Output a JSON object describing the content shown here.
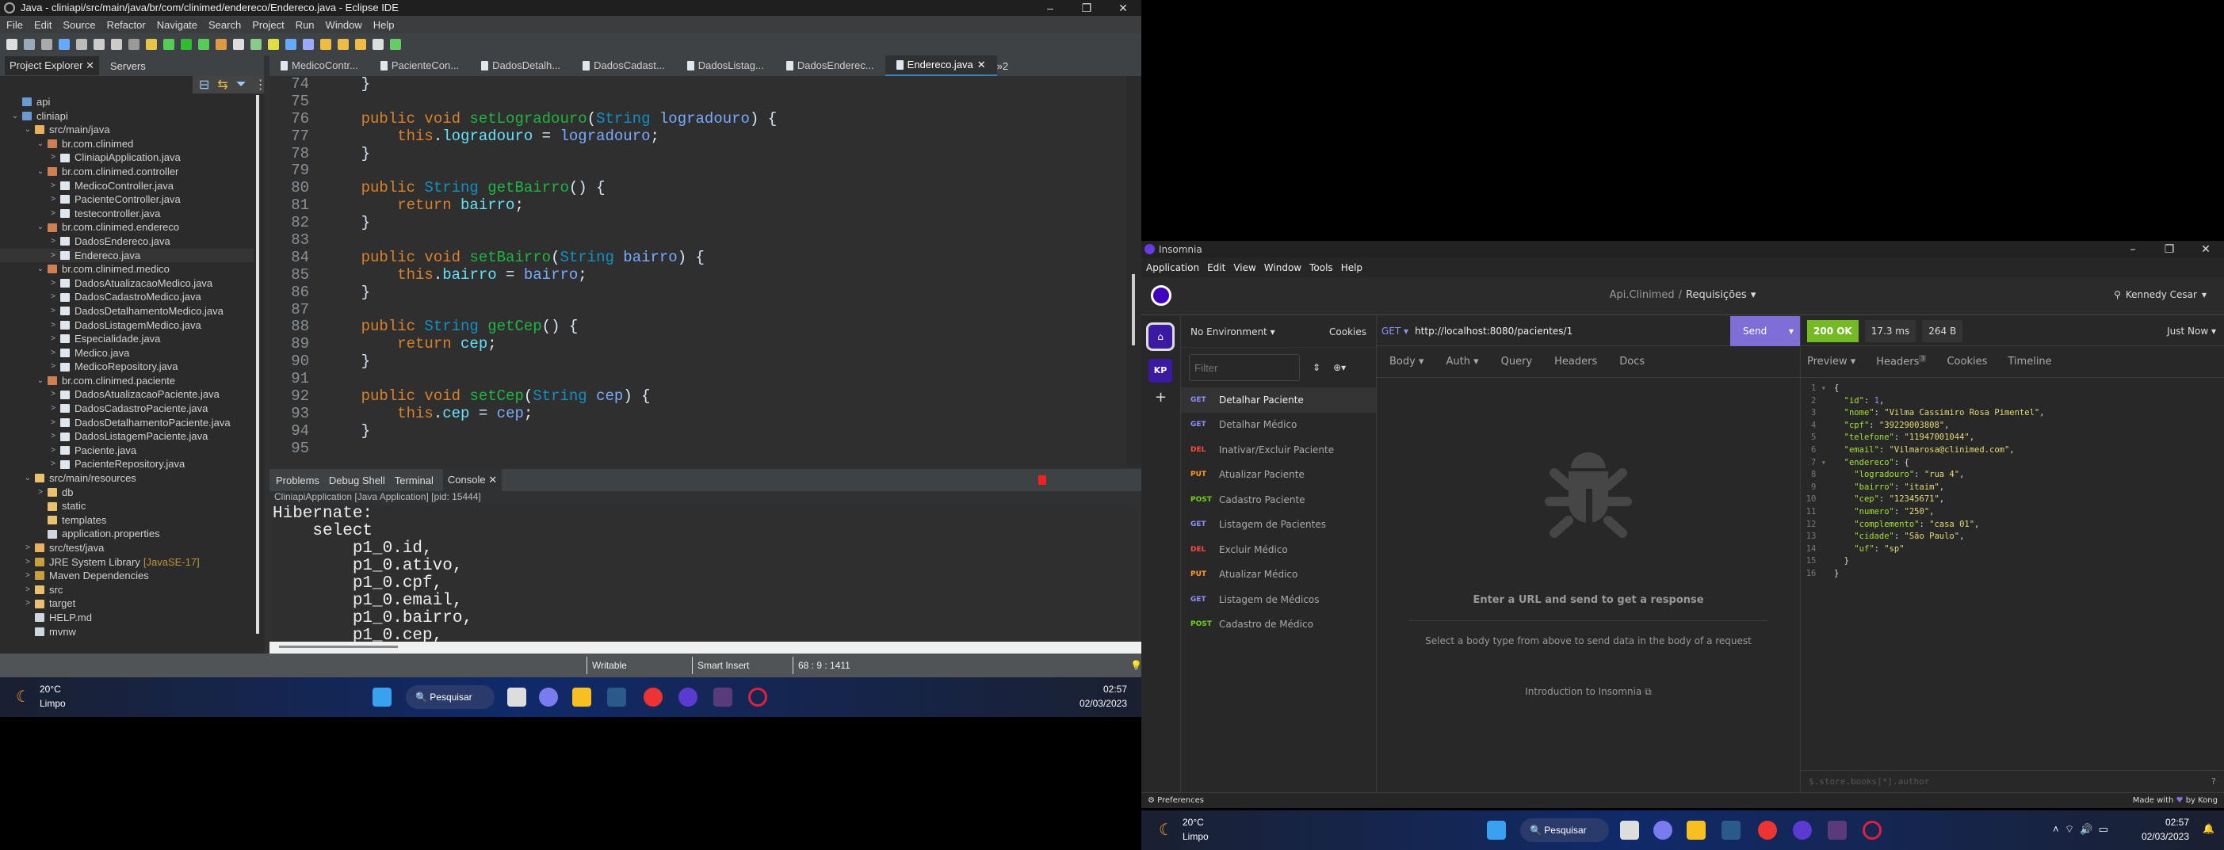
{
  "eclipse": {
    "title": "Java - cliniapi/src/main/java/br/com/clinimed/endereco/Endereco.java - Eclipse IDE",
    "window_controls": [
      "–",
      "❐",
      "✕"
    ],
    "menu": [
      "File",
      "Edit",
      "Source",
      "Refactor",
      "Navigate",
      "Search",
      "Project",
      "Run",
      "Window",
      "Help"
    ],
    "explorer_tabs": [
      "Project Explorer",
      "Servers"
    ],
    "tree": [
      {
        "d": 0,
        "c": "",
        "t": "api",
        "i": "project"
      },
      {
        "d": 0,
        "c": "⌄",
        "t": "cliniapi",
        "i": "project"
      },
      {
        "d": 1,
        "c": "⌄",
        "t": "src/main/java",
        "i": "srcfolder"
      },
      {
        "d": 2,
        "c": "⌄",
        "t": "br.com.clinimed",
        "i": "package"
      },
      {
        "d": 3,
        "c": ">",
        "t": "CliniapiApplication.java",
        "i": "java"
      },
      {
        "d": 2,
        "c": "⌄",
        "t": "br.com.clinimed.controller",
        "i": "package"
      },
      {
        "d": 3,
        "c": ">",
        "t": "MedicoController.java",
        "i": "java"
      },
      {
        "d": 3,
        "c": ">",
        "t": "PacienteController.java",
        "i": "java"
      },
      {
        "d": 3,
        "c": ">",
        "t": "testecontroller.java",
        "i": "java"
      },
      {
        "d": 2,
        "c": "⌄",
        "t": "br.com.clinimed.endereco",
        "i": "package"
      },
      {
        "d": 3,
        "c": ">",
        "t": "DadosEndereco.java",
        "i": "java"
      },
      {
        "d": 3,
        "c": ">",
        "t": "Endereco.java",
        "i": "java"
      },
      {
        "d": 2,
        "c": "⌄",
        "t": "br.com.clinimed.medico",
        "i": "package"
      },
      {
        "d": 3,
        "c": ">",
        "t": "DadosAtualizacaoMedico.java",
        "i": "java"
      },
      {
        "d": 3,
        "c": ">",
        "t": "DadosCadastroMedico.java",
        "i": "java"
      },
      {
        "d": 3,
        "c": ">",
        "t": "DadosDetalhamentoMedico.java",
        "i": "java"
      },
      {
        "d": 3,
        "c": ">",
        "t": "DadosListagemMedico.java",
        "i": "java"
      },
      {
        "d": 3,
        "c": ">",
        "t": "Especialidade.java",
        "i": "java"
      },
      {
        "d": 3,
        "c": ">",
        "t": "Medico.java",
        "i": "java"
      },
      {
        "d": 3,
        "c": ">",
        "t": "MedicoRepository.java",
        "i": "java"
      },
      {
        "d": 2,
        "c": "⌄",
        "t": "br.com.clinimed.paciente",
        "i": "package"
      },
      {
        "d": 3,
        "c": ">",
        "t": "DadosAtualizacaoPaciente.java",
        "i": "java"
      },
      {
        "d": 3,
        "c": ">",
        "t": "DadosCadastroPaciente.java",
        "i": "java"
      },
      {
        "d": 3,
        "c": ">",
        "t": "DadosDetalhamentoPaciente.java",
        "i": "java"
      },
      {
        "d": 3,
        "c": ">",
        "t": "DadosListagemPaciente.java",
        "i": "java"
      },
      {
        "d": 3,
        "c": ">",
        "t": "Paciente.java",
        "i": "java"
      },
      {
        "d": 3,
        "c": ">",
        "t": "PacienteRepository.java",
        "i": "java"
      },
      {
        "d": 1,
        "c": "⌄",
        "t": "src/main/resources",
        "i": "folder"
      },
      {
        "d": 2,
        "c": ">",
        "t": "db",
        "i": "folder"
      },
      {
        "d": 2,
        "c": "",
        "t": "static",
        "i": "folder"
      },
      {
        "d": 2,
        "c": "",
        "t": "templates",
        "i": "folder"
      },
      {
        "d": 2,
        "c": "",
        "t": "application.properties",
        "i": "file"
      },
      {
        "d": 1,
        "c": ">",
        "t": "src/test/java",
        "i": "srcfolder"
      },
      {
        "d": 1,
        "c": ">",
        "t": "JRE System Library",
        "i": "library",
        "dec": "[JavaSE-17]"
      },
      {
        "d": 1,
        "c": ">",
        "t": "Maven Dependencies",
        "i": "library"
      },
      {
        "d": 1,
        "c": ">",
        "t": "src",
        "i": "folder"
      },
      {
        "d": 1,
        "c": ">",
        "t": "target",
        "i": "folder"
      },
      {
        "d": 1,
        "c": "",
        "t": "HELP.md",
        "i": "file"
      },
      {
        "d": 1,
        "c": "",
        "t": "mvnw",
        "i": "file"
      }
    ],
    "editor_tabs": [
      "MedicoContr...",
      "PacienteCon...",
      "DadosDetalh...",
      "DadosCadast...",
      "DadosListag...",
      "DadosEnderec...",
      "Endereco.java"
    ],
    "editor_tabs_overflow": "»2",
    "code": [
      {
        "n": "74",
        "tk": [
          [
            "o",
            "    }"
          ]
        ]
      },
      {
        "n": "75",
        "tk": []
      },
      {
        "n": "76",
        "tk": [
          [
            "k",
            "    public void "
          ],
          [
            "m",
            "setLogradouro"
          ],
          [
            "o",
            "("
          ],
          [
            "t",
            "String "
          ],
          [
            "p",
            "logradouro"
          ],
          [
            "o",
            ") {"
          ]
        ]
      },
      {
        "n": "77",
        "tk": [
          [
            "k",
            "        this"
          ],
          [
            "o",
            "."
          ],
          [
            "f",
            "logradouro"
          ],
          [
            "o",
            " = "
          ],
          [
            "p",
            "logradouro"
          ],
          [
            "o",
            ";"
          ]
        ]
      },
      {
        "n": "78",
        "tk": [
          [
            "o",
            "    }"
          ]
        ]
      },
      {
        "n": "79",
        "tk": []
      },
      {
        "n": "80",
        "tk": [
          [
            "k",
            "    public "
          ],
          [
            "t",
            "String "
          ],
          [
            "m",
            "getBairro"
          ],
          [
            "o",
            "() {"
          ]
        ]
      },
      {
        "n": "81",
        "tk": [
          [
            "k",
            "        return "
          ],
          [
            "f",
            "bairro"
          ],
          [
            "o",
            ";"
          ]
        ]
      },
      {
        "n": "82",
        "tk": [
          [
            "o",
            "    }"
          ]
        ]
      },
      {
        "n": "83",
        "tk": []
      },
      {
        "n": "84",
        "tk": [
          [
            "k",
            "    public void "
          ],
          [
            "m",
            "setBairro"
          ],
          [
            "o",
            "("
          ],
          [
            "t",
            "String "
          ],
          [
            "p",
            "bairro"
          ],
          [
            "o",
            ") {"
          ]
        ]
      },
      {
        "n": "85",
        "tk": [
          [
            "k",
            "        this"
          ],
          [
            "o",
            "."
          ],
          [
            "f",
            "bairro"
          ],
          [
            "o",
            " = "
          ],
          [
            "p",
            "bairro"
          ],
          [
            "o",
            ";"
          ]
        ]
      },
      {
        "n": "86",
        "tk": [
          [
            "o",
            "    }"
          ]
        ]
      },
      {
        "n": "87",
        "tk": []
      },
      {
        "n": "88",
        "tk": [
          [
            "k",
            "    public "
          ],
          [
            "t",
            "String "
          ],
          [
            "m",
            "getCep"
          ],
          [
            "o",
            "() {"
          ]
        ]
      },
      {
        "n": "89",
        "tk": [
          [
            "k",
            "        return "
          ],
          [
            "f",
            "cep"
          ],
          [
            "o",
            ";"
          ]
        ]
      },
      {
        "n": "90",
        "tk": [
          [
            "o",
            "    }"
          ]
        ]
      },
      {
        "n": "91",
        "tk": []
      },
      {
        "n": "92",
        "tk": [
          [
            "k",
            "    public void "
          ],
          [
            "m",
            "setCep"
          ],
          [
            "o",
            "("
          ],
          [
            "t",
            "String "
          ],
          [
            "p",
            "cep"
          ],
          [
            "o",
            ") {"
          ]
        ]
      },
      {
        "n": "93",
        "tk": [
          [
            "k",
            "        this"
          ],
          [
            "o",
            "."
          ],
          [
            "f",
            "cep"
          ],
          [
            "o",
            " = "
          ],
          [
            "p",
            "cep"
          ],
          [
            "o",
            ";"
          ]
        ]
      },
      {
        "n": "94",
        "tk": [
          [
            "o",
            "    }"
          ]
        ]
      },
      {
        "n": "95",
        "tk": []
      }
    ],
    "console_tabs": [
      "Problems",
      "Debug Shell",
      "Terminal",
      "Console"
    ],
    "console_header": "CliniapiApplication [Java Application]  [pid: 15444]",
    "console_lines": [
      "Hibernate:",
      "    select",
      "        p1_0.id,",
      "        p1_0.ativo,",
      "        p1_0.cpf,",
      "        p1_0.email,",
      "        p1_0.bairro,",
      "        p1_0.cep,"
    ],
    "status": {
      "writable": "Writable",
      "insert": "Smart Insert",
      "position": "68 : 9 : 1411"
    }
  },
  "taskbar": {
    "weather_temp": "20°C",
    "weather_desc": "Limpo",
    "search": "Pesquisar",
    "time": "02:57",
    "date": "02/03/2023"
  },
  "insomnia": {
    "title": "Insomnia",
    "window_controls": [
      "–",
      "❐",
      "✕"
    ],
    "menu": [
      "Application",
      "Edit",
      "View",
      "Window",
      "Tools",
      "Help"
    ],
    "breadcrumb_project": "Api.Clinimed",
    "breadcrumb_sep": "/",
    "breadcrumb_collection": "Requisições",
    "user": "Kennedy Cesar",
    "rail_badge": "KP",
    "environment": "No Environment",
    "cookies": "Cookies",
    "filter_placeholder": "Filter",
    "requests": [
      {
        "m": "GET",
        "n": "Detalhar Paciente",
        "active": true
      },
      {
        "m": "GET",
        "n": "Detalhar Médico"
      },
      {
        "m": "DEL",
        "n": "Inativar/Excluir Paciente"
      },
      {
        "m": "PUT",
        "n": "Atualizar Paciente"
      },
      {
        "m": "POST",
        "n": "Cadastro Paciente"
      },
      {
        "m": "GET",
        "n": "Listagem de Pacientes"
      },
      {
        "m": "DEL",
        "n": "Excluir Médico"
      },
      {
        "m": "PUT",
        "n": "Atualizar Médico"
      },
      {
        "m": "GET",
        "n": "Listagem de Médicos"
      },
      {
        "m": "POST",
        "n": "Cadastro de Médico"
      }
    ],
    "method_colors": {
      "GET": "#8f8fff",
      "DEL": "#ff4a3d",
      "PUT": "#ff9a1f",
      "POST": "#73d216"
    },
    "method": "GET",
    "url": "http://localhost:8080/pacientes/1",
    "send": "Send",
    "status_code": "200 OK",
    "time": "17.3 ms",
    "size": "264 B",
    "when": "Just Now",
    "req_tabs": [
      "Body",
      "Auth",
      "Query",
      "Headers",
      "Docs"
    ],
    "resp_tabs": [
      "Preview",
      "Headers",
      "Cookies",
      "Timeline"
    ],
    "headers_count": "3",
    "empty_title": "Enter a URL and send to get a response",
    "empty_sub": "Select a body type from above to send data in the body of a request",
    "intro_link": "Introduction to Insomnia",
    "json_lines": [
      [
        [
          "jp",
          "{"
        ]
      ],
      [
        [
          "jp",
          "  "
        ],
        [
          "jk",
          "\"id\""
        ],
        [
          "jp",
          ": "
        ],
        [
          "jn",
          "1"
        ],
        [
          "jp",
          ","
        ]
      ],
      [
        [
          "jp",
          "  "
        ],
        [
          "jk",
          "\"nome\""
        ],
        [
          "jp",
          ": "
        ],
        [
          "js",
          "\"Vilma Cassimiro Rosa Pimentel\""
        ],
        [
          "jp",
          ","
        ]
      ],
      [
        [
          "jp",
          "  "
        ],
        [
          "jk",
          "\"cpf\""
        ],
        [
          "jp",
          ": "
        ],
        [
          "js",
          "\"39229003808\""
        ],
        [
          "jp",
          ","
        ]
      ],
      [
        [
          "jp",
          "  "
        ],
        [
          "jk",
          "\"telefone\""
        ],
        [
          "jp",
          ": "
        ],
        [
          "js",
          "\"11947001044\""
        ],
        [
          "jp",
          ","
        ]
      ],
      [
        [
          "jp",
          "  "
        ],
        [
          "jk",
          "\"email\""
        ],
        [
          "jp",
          ": "
        ],
        [
          "js",
          "\"Vilmarosa@clinimed.com\""
        ],
        [
          "jp",
          ","
        ]
      ],
      [
        [
          "jp",
          "  "
        ],
        [
          "jk",
          "\"endereco\""
        ],
        [
          "jp",
          ": {"
        ]
      ],
      [
        [
          "jp",
          "    "
        ],
        [
          "jk",
          "\"logradouro\""
        ],
        [
          "jp",
          ": "
        ],
        [
          "js",
          "\"rua 4\""
        ],
        [
          "jp",
          ","
        ]
      ],
      [
        [
          "jp",
          "    "
        ],
        [
          "jk",
          "\"bairro\""
        ],
        [
          "jp",
          ": "
        ],
        [
          "js",
          "\"itaim\""
        ],
        [
          "jp",
          ","
        ]
      ],
      [
        [
          "jp",
          "    "
        ],
        [
          "jk",
          "\"cep\""
        ],
        [
          "jp",
          ": "
        ],
        [
          "js",
          "\"12345671\""
        ],
        [
          "jp",
          ","
        ]
      ],
      [
        [
          "jp",
          "    "
        ],
        [
          "jk",
          "\"numero\""
        ],
        [
          "jp",
          ": "
        ],
        [
          "js",
          "\"250\""
        ],
        [
          "jp",
          ","
        ]
      ],
      [
        [
          "jp",
          "    "
        ],
        [
          "jk",
          "\"complemento\""
        ],
        [
          "jp",
          ": "
        ],
        [
          "js",
          "\"casa 01\""
        ],
        [
          "jp",
          ","
        ]
      ],
      [
        [
          "jp",
          "    "
        ],
        [
          "jk",
          "\"cidade\""
        ],
        [
          "jp",
          ": "
        ],
        [
          "js",
          "\"São Paulo\""
        ],
        [
          "jp",
          ","
        ]
      ],
      [
        [
          "jp",
          "    "
        ],
        [
          "jk",
          "\"uf\""
        ],
        [
          "jp",
          ": "
        ],
        [
          "js",
          "\"sp\""
        ]
      ],
      [
        [
          "jp",
          "  }"
        ]
      ],
      [
        [
          "jp",
          "}"
        ]
      ]
    ],
    "filter_json_placeholder": "$.store.books[*].author",
    "preferences": "Preferences",
    "made_with": "Made with",
    "by_kong": "by Kong",
    "accent": "#7b5fd0",
    "success": "#75ba24"
  }
}
